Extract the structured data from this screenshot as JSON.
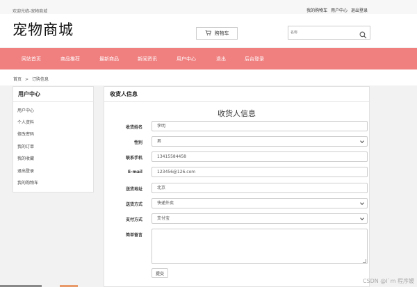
{
  "topbar": {
    "welcome": "欢迎光临-宠物商城",
    "links": [
      "我的购物车",
      "用户中心",
      "退出登录"
    ]
  },
  "header": {
    "logo": "宠物商城",
    "cart_label": "购物车",
    "search_placeholder": "名称"
  },
  "nav": {
    "items": [
      "网站首页",
      "商品推荐",
      "最新商品",
      "新闻资讯",
      "用户中心",
      "退出",
      "后台登录"
    ]
  },
  "breadcrumb": {
    "home": "首页",
    "separator": ">",
    "current": "订购信息"
  },
  "sidebar": {
    "title": "用户中心",
    "items": [
      "用户中心",
      "个人资料",
      "修改密码",
      "我的订单",
      "我的收藏",
      "退出登录",
      "我的购物车"
    ]
  },
  "main": {
    "panel_title": "收货人信息",
    "form_heading": "收货人信息",
    "fields": [
      {
        "label": "收货姓名",
        "value": "李明"
      },
      {
        "label": "性别",
        "value": "男"
      },
      {
        "label": "联系手机",
        "value": "13415584458"
      },
      {
        "label": "E-mail",
        "value": "123456@126.com"
      },
      {
        "label": "送货地址",
        "value": "北京"
      },
      {
        "label": "送货方式",
        "value": "快递外卖"
      },
      {
        "label": "支付方式",
        "value": "支付宝"
      },
      {
        "label": "简单留言",
        "value": ""
      }
    ],
    "submit_label": "提交"
  },
  "watermark": "CSDN @I`m 程序媛",
  "colors": {
    "nav_bg": "#f07f7f",
    "page_bg": "#f2f2f2"
  }
}
